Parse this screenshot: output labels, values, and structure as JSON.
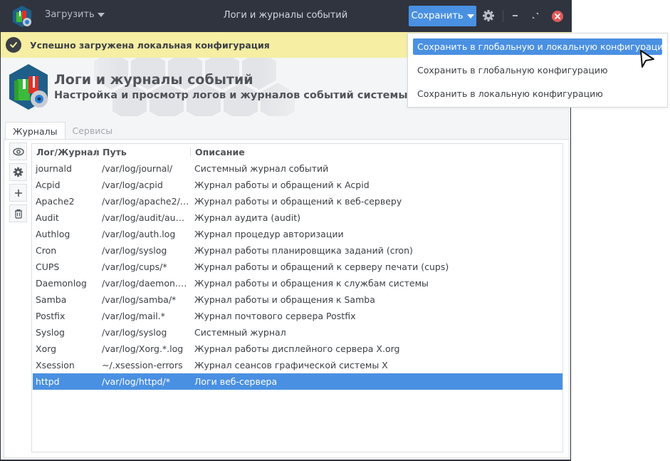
{
  "window": {
    "title": "Логи и журналы событий",
    "load_label": "Загрузить",
    "save_label": "Сохранить"
  },
  "notification": {
    "text": "Успешно загружена локальная конфигурация"
  },
  "header": {
    "title": "Логи и журналы событий",
    "subtitle": "Настройка и просмотр логов и журналов событий системы"
  },
  "tabs": [
    {
      "label": "Журналы",
      "active": true
    },
    {
      "label": "Сервисы",
      "active": false
    }
  ],
  "side_toolbar": [
    "eye-icon",
    "gear-icon",
    "plus-icon",
    "trash-icon"
  ],
  "table": {
    "columns": [
      "Лог/Журнал",
      "Путь",
      "Описание"
    ],
    "rows": [
      {
        "name": "journald",
        "path": "/var/log/journal/",
        "desc": "Системный журнал событий"
      },
      {
        "name": "Acpid",
        "path": "/var/log/acpid",
        "desc": "Журнал работы и обращений к Acpid"
      },
      {
        "name": "Apache2",
        "path": "/var/log/apache2/…",
        "desc": "Журнал работы и обращений к веб-серверу"
      },
      {
        "name": "Audit",
        "path": "/var/log/audit/au…",
        "desc": "Журнал аудита (audit)"
      },
      {
        "name": "Authlog",
        "path": "/var/log/auth.log",
        "desc": "Журнал процедур авторизации"
      },
      {
        "name": "Cron",
        "path": "/var/log/syslog",
        "desc": "Журнал работы планировщика заданий (cron)"
      },
      {
        "name": "CUPS",
        "path": "/var/log/cups/*",
        "desc": "Журнал работы и обращений к серверу печати (cups)"
      },
      {
        "name": "Daemonlog",
        "path": "/var/log/daemon.…",
        "desc": "Журнал работы и обращения к службам системы"
      },
      {
        "name": "Samba",
        "path": "/var/log/samba/*",
        "desc": "Журнал работы и обращения к Samba"
      },
      {
        "name": "Postfix",
        "path": "/var/log/mail.*",
        "desc": "Журнал почтового сервера Postfix"
      },
      {
        "name": "Syslog",
        "path": "/var/log/syslog",
        "desc": "Системный журнал"
      },
      {
        "name": "Xorg",
        "path": "/var/log/Xorg.*.log",
        "desc": "Журнал работы дисплейного сервера X.org"
      },
      {
        "name": "Xsession",
        "path": "~/.xsession-errors",
        "desc": "Журнал сеансов графической системы X"
      },
      {
        "name": "httpd",
        "path": "/var/log/httpd/*",
        "desc": "Логи веб-сервера"
      }
    ],
    "selected_index": 13
  },
  "save_menu": {
    "items": [
      "Сохранить в глобальную и локальную конфигурацию",
      "Сохранить в глобальную конфигурацию",
      "Сохранить в локальную конфигурацию"
    ],
    "highlighted_index": 0
  },
  "colors": {
    "titlebar": "#2f343f",
    "accent": "#4a90e2",
    "notice_bg": "#f5eea3",
    "close": "#e05a5a"
  }
}
